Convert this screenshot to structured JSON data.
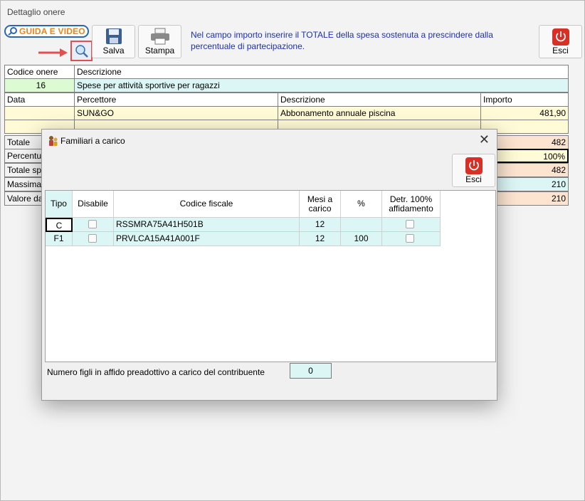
{
  "window": {
    "title": "Dettaglio onere"
  },
  "toolbar": {
    "guida_label": "GUIDA E VIDEO",
    "salva_label": "Salva",
    "stampa_label": "Stampa",
    "esci_label": "Esci",
    "info": "Nel campo importo inserire il TOTALE della spesa sostenuta a prescindere dalla percentuale di partecipazione."
  },
  "onere": {
    "codice_header": "Codice onere",
    "descrizione_header": "Descrizione",
    "codice": "16",
    "descrizione": "Spese per attività sportive per ragazzi"
  },
  "spese": {
    "headers": {
      "data": "Data",
      "percettore": "Percettore",
      "descrizione": "Descrizione",
      "importo": "Importo"
    },
    "rows": [
      {
        "data": "",
        "percettore": "SUN&GO",
        "descrizione": "Abbonamento annuale piscina",
        "importo": "481,90"
      },
      {
        "data": "",
        "percettore": "",
        "descrizione": "",
        "importo": ""
      }
    ]
  },
  "totali": [
    {
      "label": "Totale",
      "value": "482"
    },
    {
      "label": "Percentua",
      "value": "100%"
    },
    {
      "label": "Totale spe",
      "value": "482"
    },
    {
      "label": "Massimal",
      "value": "210"
    },
    {
      "label": "Valore da",
      "value": "210"
    }
  ],
  "dialog": {
    "title": "Familiari a carico",
    "esci_label": "Esci",
    "headers": {
      "tipo": "Tipo",
      "disabile": "Disabile",
      "codice_fiscale": "Codice fiscale",
      "mesi": "Mesi a carico",
      "perc": "%",
      "detr": "Detr. 100% affidamento"
    },
    "rows": [
      {
        "tipo": "C",
        "disabile": false,
        "codice_fiscale": "RSSMRA75A41H501B",
        "mesi": "12",
        "perc": "",
        "detr": false
      },
      {
        "tipo": "F1",
        "disabile": false,
        "codice_fiscale": "PRVLCA15A41A001F",
        "mesi": "12",
        "perc": "100",
        "detr": false
      }
    ],
    "figli_label": "Numero figli in affido preadottivo a carico del contribuente",
    "figli_value": "0"
  },
  "colors": {
    "accent_red": "#d93025",
    "yellow_cell": "#fffbd6",
    "cyan_cell": "#dcf6f6",
    "green_cell": "#ddfbd2",
    "orange_cell": "#fde4d0"
  }
}
